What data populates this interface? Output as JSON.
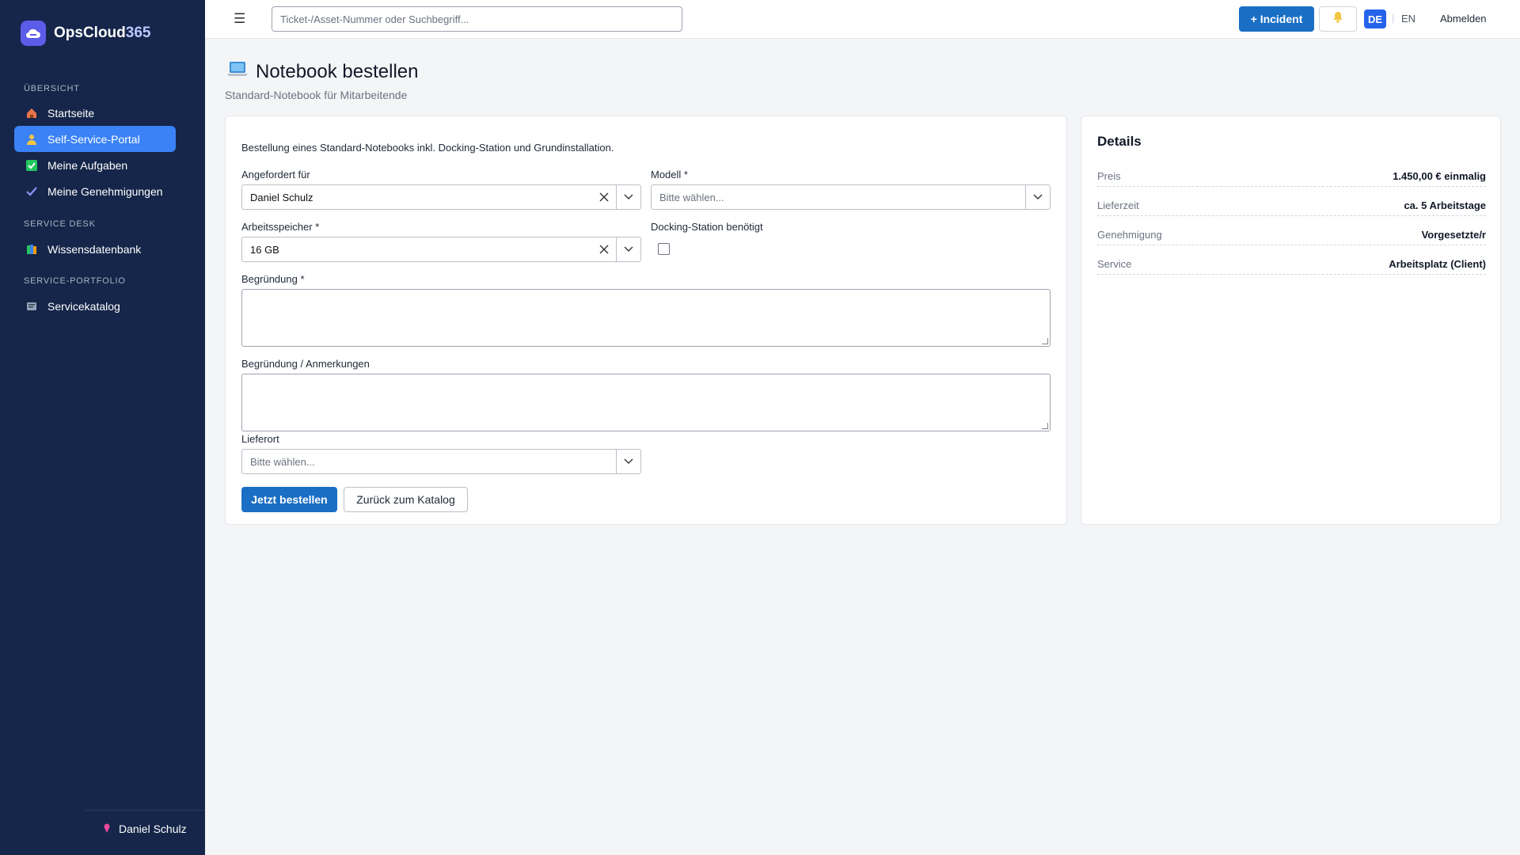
{
  "app": {
    "brand_name": "OpsCloud",
    "brand_accent": "365"
  },
  "sidebar": {
    "sections": [
      {
        "label": "ÜBERSICHT"
      },
      {
        "label": "SERVICE DESK"
      },
      {
        "label": "SERVICE-PORTFOLIO"
      }
    ],
    "items": [
      {
        "label": "Startseite",
        "icon": "home-icon",
        "active": false
      },
      {
        "label": "Self-Service-Portal",
        "icon": "person-icon",
        "active": true
      },
      {
        "label": "Meine Aufgaben",
        "icon": "checkbox-icon",
        "active": false
      },
      {
        "label": "Meine Genehmigungen",
        "icon": "checkmark-icon",
        "active": false
      },
      {
        "label": "Wissensdatenbank",
        "icon": "books-icon",
        "active": false
      },
      {
        "label": "Servicekatalog",
        "icon": "catalog-icon",
        "active": false
      }
    ],
    "user_name": "Daniel Schulz"
  },
  "topbar": {
    "search_placeholder": "Ticket-/Asset-Nummer oder Suchbegriff...",
    "incident_label": "+ Incident",
    "lang_de": "DE",
    "lang_separator": "|",
    "lang_en": "EN",
    "logout_label": "Abmelden"
  },
  "page": {
    "title": "Notebook bestellen",
    "subtitle": "Standard-Notebook für Mitarbeitende"
  },
  "form": {
    "intro": "Bestellung eines Standard-Notebooks inkl. Docking-Station und Grundinstallation.",
    "requested_for": {
      "label": "Angefordert für",
      "value": "Daniel Schulz"
    },
    "model": {
      "label": "Modell *",
      "placeholder": "Bitte wählen..."
    },
    "memory": {
      "label": "Arbeitsspeicher *",
      "value": "16 GB"
    },
    "docking": {
      "label": "Docking-Station benötigt",
      "checked": false
    },
    "justification": {
      "label": "Begründung *",
      "value": ""
    },
    "remarks": {
      "label": "Begründung / Anmerkungen",
      "value": ""
    },
    "location": {
      "label": "Lieferort",
      "placeholder": "Bitte wählen..."
    },
    "submit_label": "Jetzt bestellen",
    "back_label": "Zurück zum Katalog"
  },
  "details": {
    "title": "Details",
    "rows": [
      {
        "key": "Preis",
        "value": "1.450,00 € einmalig"
      },
      {
        "key": "Lieferzeit",
        "value": "ca. 5 Arbeitstage"
      },
      {
        "key": "Genehmigung",
        "value": "Vorgesetzte/r"
      },
      {
        "key": "Service",
        "value": "Arbeitsplatz (Client)"
      }
    ]
  },
  "colors": {
    "sidebar_bg": "#15264a",
    "active_nav": "#3b82f6",
    "primary": "#1a6fc4"
  }
}
